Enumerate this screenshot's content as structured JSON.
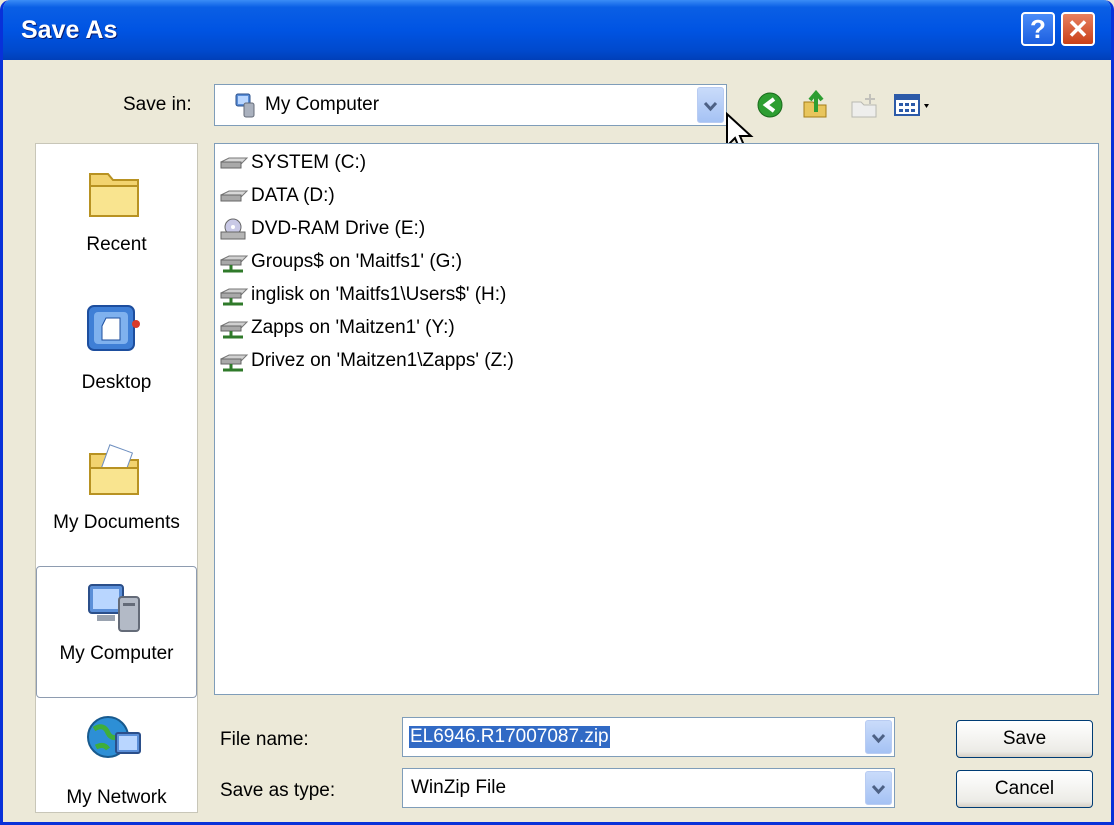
{
  "window": {
    "title": "Save As"
  },
  "toolbar": {
    "save_in_label": "Save in:",
    "save_in_value": "My Computer",
    "icons": [
      "back-icon",
      "up-folder-icon",
      "new-folder-icon",
      "views-menu-icon"
    ]
  },
  "places": [
    {
      "label": "Recent",
      "icon": "recent-folder-icon"
    },
    {
      "label": "Desktop",
      "icon": "desktop-icon"
    },
    {
      "label": "My Documents",
      "icon": "my-documents-icon"
    },
    {
      "label": "My Computer",
      "icon": "my-computer-icon",
      "selected": true
    },
    {
      "label": "My Network",
      "icon": "my-network-icon"
    }
  ],
  "files": [
    {
      "label": "SYSTEM (C:)",
      "icon": "hard-drive-icon"
    },
    {
      "label": "DATA (D:)",
      "icon": "hard-drive-icon"
    },
    {
      "label": "DVD-RAM Drive (E:)",
      "icon": "dvd-drive-icon"
    },
    {
      "label": "Groups$ on 'Maitfs1' (G:)",
      "icon": "network-drive-icon"
    },
    {
      "label": "inglisk on 'Maitfs1\\Users$' (H:)",
      "icon": "network-drive-icon"
    },
    {
      "label": "Zapps on 'Maitzen1' (Y:)",
      "icon": "network-drive-icon"
    },
    {
      "label": "Drivez on 'Maitzen1\\Zapps' (Z:)",
      "icon": "network-drive-icon"
    }
  ],
  "form": {
    "filename_label": "File name:",
    "filename_value": "EL6946.R17007087.zip",
    "type_label": "Save as type:",
    "type_value": "WinZip File",
    "save_button": "Save",
    "cancel_button": "Cancel"
  },
  "titlebar_buttons": {
    "help": "?",
    "close": "✕"
  },
  "colors": {
    "titlebar": "#0054e3",
    "dialog": "#ece9d8",
    "selection": "#316ac5"
  }
}
